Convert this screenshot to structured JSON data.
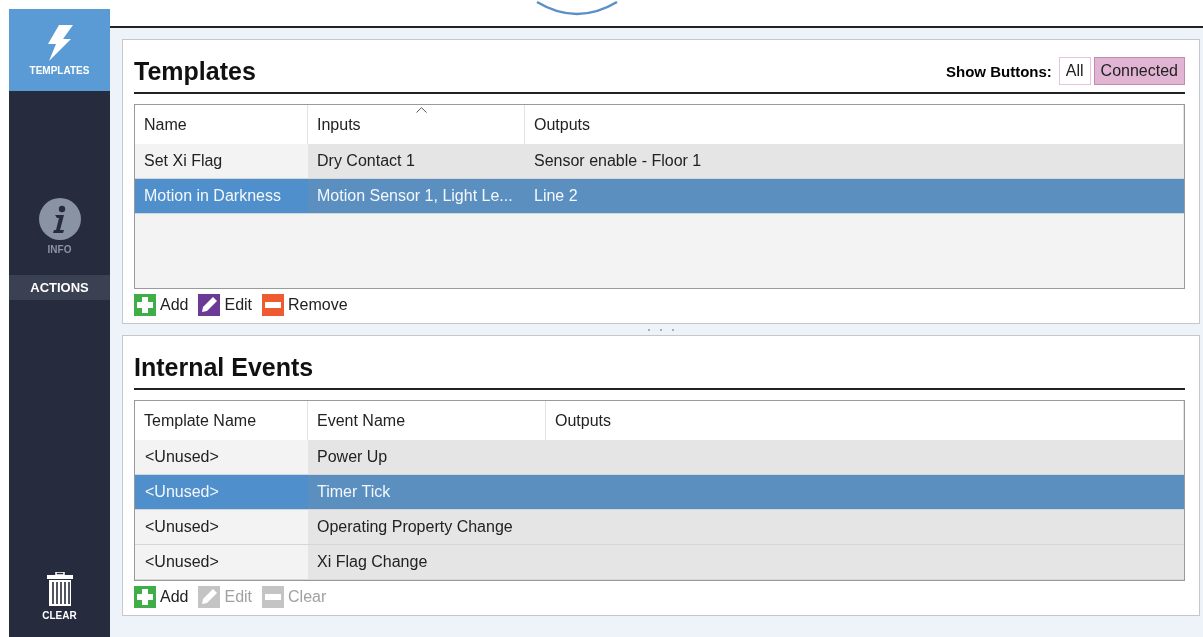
{
  "sidebar": {
    "items": [
      {
        "label": "TEMPLATES",
        "kind": "templates",
        "selected": true
      },
      {
        "label": "INFO",
        "kind": "info",
        "selected": false
      }
    ],
    "section": "ACTIONS",
    "clear": {
      "label": "CLEAR"
    }
  },
  "panels": [
    {
      "title": "Templates",
      "show_buttons": {
        "label": "Show Buttons:",
        "options": [
          {
            "label": "All",
            "selected": false
          },
          {
            "label": "Connected",
            "selected": true
          }
        ]
      },
      "table": {
        "columns": [
          {
            "label": "Name",
            "sorted": false
          },
          {
            "label": "Inputs",
            "sorted": true
          },
          {
            "label": "Outputs",
            "sorted": false
          }
        ],
        "rows": [
          {
            "cells": [
              "Set Xi Flag",
              "Dry Contact 1",
              "Sensor enable - Floor 1"
            ],
            "selected": false
          },
          {
            "cells": [
              "Motion in Darkness",
              "Motion Sensor 1, Light Le...",
              "Line 2"
            ],
            "selected": true
          }
        ]
      },
      "actions": [
        {
          "label": "Add",
          "kind": "add",
          "disabled": false
        },
        {
          "label": "Edit",
          "kind": "edit",
          "disabled": false
        },
        {
          "label": "Remove",
          "kind": "remove",
          "disabled": false
        }
      ]
    },
    {
      "title": "Internal Events",
      "table": {
        "columns": [
          {
            "label": "Template Name",
            "sorted": false
          },
          {
            "label": "Event Name",
            "sorted": false
          },
          {
            "label": "Outputs",
            "sorted": false
          }
        ],
        "rows": [
          {
            "cells": [
              "<Unused>",
              "Power Up",
              ""
            ],
            "selected": false
          },
          {
            "cells": [
              "<Unused>",
              "Timer Tick",
              ""
            ],
            "selected": true
          },
          {
            "cells": [
              "<Unused>",
              "Operating Property Change",
              ""
            ],
            "selected": false
          },
          {
            "cells": [
              "<Unused>",
              "Xi Flag Change",
              ""
            ],
            "selected": false
          }
        ]
      },
      "actions": [
        {
          "label": "Add",
          "kind": "add",
          "disabled": false
        },
        {
          "label": "Edit",
          "kind": "edit",
          "disabled": true
        },
        {
          "label": "Clear",
          "kind": "remove",
          "disabled": true
        }
      ]
    }
  ]
}
